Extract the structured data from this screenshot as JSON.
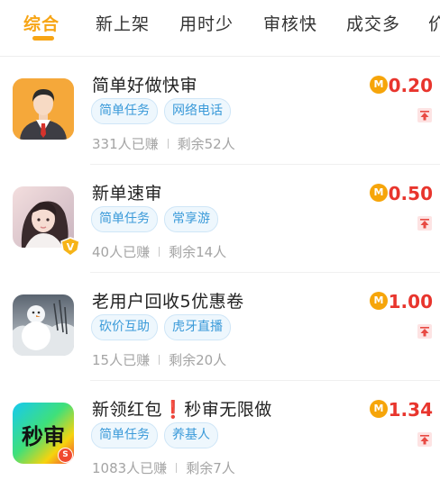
{
  "tabs": [
    {
      "label": "综合",
      "active": true
    },
    {
      "label": "新上架",
      "active": false
    },
    {
      "label": "用时少",
      "active": false
    },
    {
      "label": "审核快",
      "active": false
    },
    {
      "label": "成交多",
      "active": false
    },
    {
      "label": "价",
      "active": false
    }
  ],
  "colors": {
    "accent": "#f7a515",
    "price": "#e8352d",
    "tag_text": "#3a9ad9",
    "tag_bg": "#eef7fd"
  },
  "tasks": [
    {
      "title": "简单好做快审",
      "tags": [
        "简单任务",
        "网络电话"
      ],
      "earned": "331人已赚",
      "remaining": "剩余52人",
      "price": "0.20",
      "coin_label": "M"
    },
    {
      "title": "新单速审",
      "tags": [
        "简单任务",
        "常享游"
      ],
      "earned": "40人已赚",
      "remaining": "剩余14人",
      "price": "0.50",
      "coin_label": "M",
      "badge": "V"
    },
    {
      "title": "老用户回收5优惠卷",
      "tags": [
        "砍价互助",
        "虎牙直播"
      ],
      "earned": "15人已赚",
      "remaining": "剩余20人",
      "price": "1.00",
      "coin_label": "M"
    },
    {
      "title_part1": "新领红包",
      "title_mark": "❗",
      "title_part2": "秒审无限做",
      "tags": [
        "简单任务",
        "养基人"
      ],
      "earned": "1083人已赚",
      "remaining": "剩余7人",
      "price": "1.34",
      "coin_label": "M",
      "avatar_text": "秒审",
      "avatar_badge": "S"
    }
  ]
}
